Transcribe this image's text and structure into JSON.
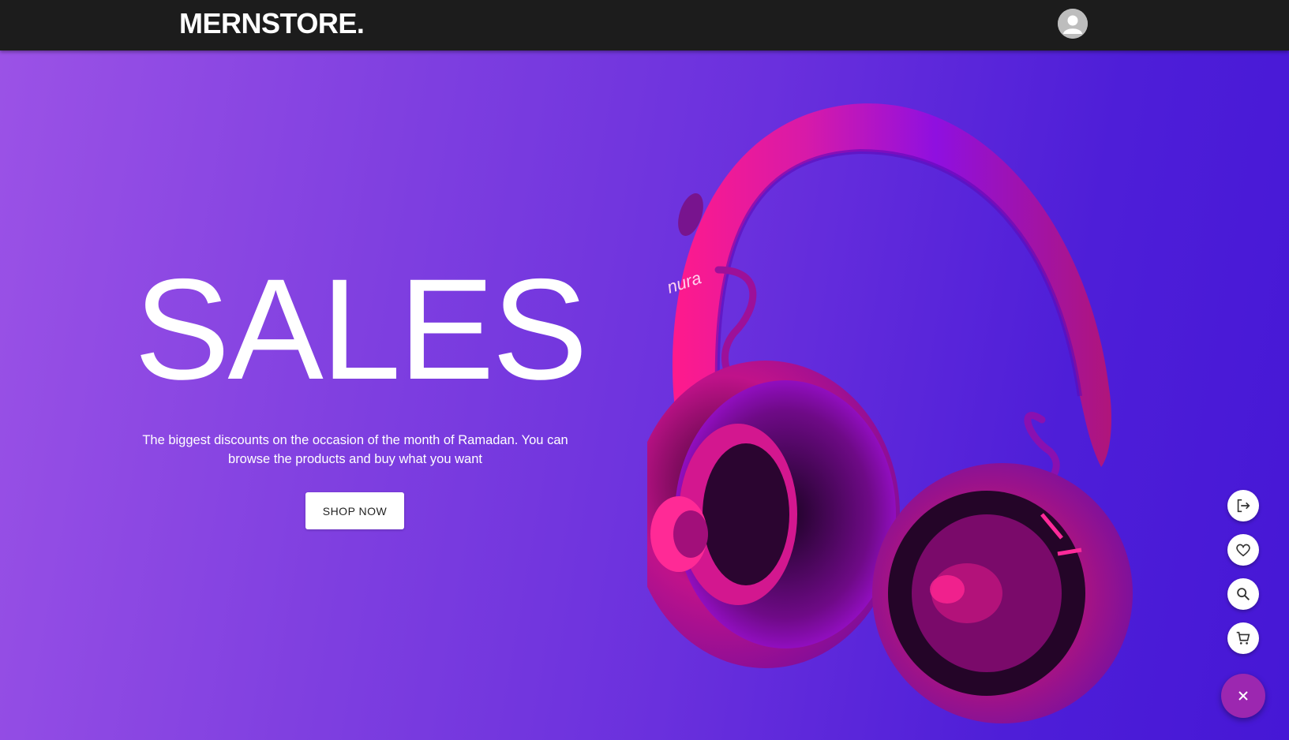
{
  "navbar": {
    "logo": "MERNSTORE.",
    "avatar_icon": "account-circle-icon"
  },
  "hero": {
    "title": "SALES",
    "description": "The biggest discounts on the occasion of the month of Ramadan. You can browse the products and buy what you want",
    "cta_label": "SHOP NOW",
    "product_brand": "nura",
    "background_gradient": [
      "#9b52e6",
      "#4617d6"
    ]
  },
  "speed_dial": {
    "actions": [
      {
        "icon": "logout-icon"
      },
      {
        "icon": "heart-icon"
      },
      {
        "icon": "search-icon"
      },
      {
        "icon": "cart-icon"
      }
    ],
    "toggle_icon": "close-icon",
    "toggle_color": "#9c27b0"
  }
}
